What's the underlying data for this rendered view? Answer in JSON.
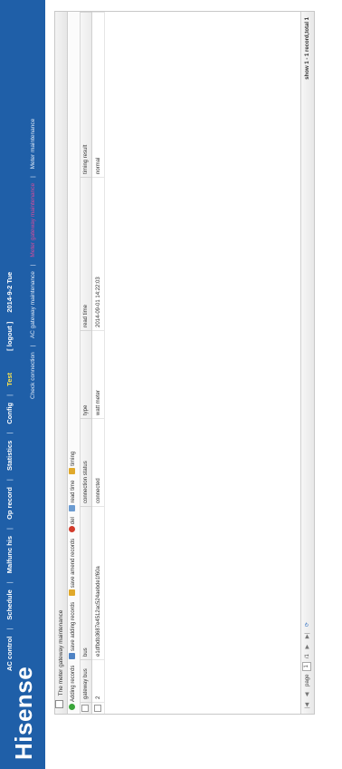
{
  "brand": "Hisense",
  "nav": {
    "items": [
      "AC control",
      "Schedule",
      "Malfunc his",
      "Op record",
      "Statistics",
      "Config",
      "Test"
    ],
    "active": "Test",
    "logout": "[ logout ]",
    "date": "2014-9-2 Tue"
  },
  "subnav": {
    "items": [
      "Check connection",
      "AC gateway maintenance",
      "Meter gateway maintenance",
      "Meter maintenance"
    ],
    "active": "Meter gateway maintenance"
  },
  "panel": {
    "title": "The meter gateway maintenance"
  },
  "toolbar": {
    "add": "Adding records",
    "save_add": "save adding records",
    "save_amend": "save amend records",
    "del": "del",
    "read_time": "read time",
    "timing": "timing"
  },
  "table": {
    "columns": [
      "gateway bus",
      "bus",
      "connection status",
      "type",
      "read time",
      "timing result"
    ],
    "rows": [
      [
        "2",
        "e1dfbdb3687e4512ac524aebde1f60a",
        "connected",
        "watt meter",
        "2014-09-01 14:22:03",
        "normal"
      ]
    ]
  },
  "pager": {
    "page_label": "page",
    "page": "1",
    "of": "/1",
    "show": "show 1 - 1 record,total 1"
  }
}
